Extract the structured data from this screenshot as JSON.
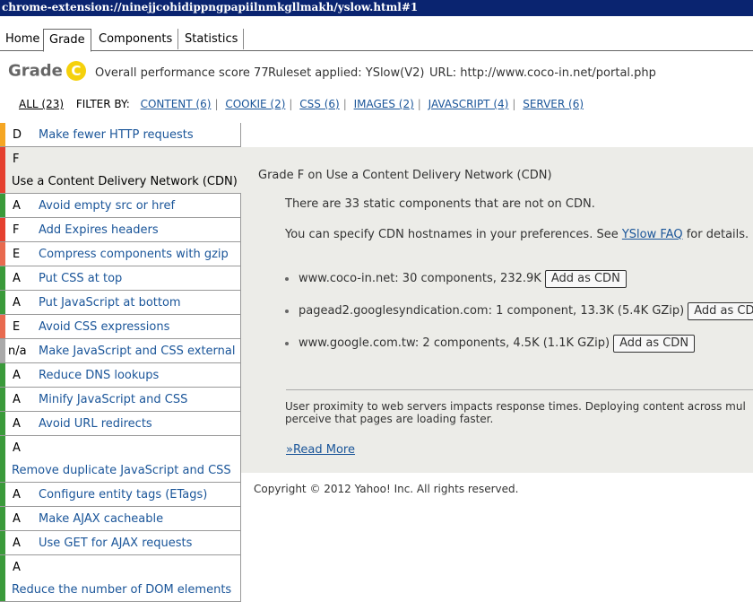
{
  "window": {
    "url": "chrome-extension://ninejjcohidippngpapiilnmkgllmakh/yslow.html#1"
  },
  "tabs": [
    {
      "label": "Home",
      "active": false
    },
    {
      "label": "Grade",
      "active": true
    },
    {
      "label": "Components",
      "active": false
    },
    {
      "label": "Statistics",
      "active": false
    }
  ],
  "header": {
    "title": "Grade",
    "grade": "C",
    "score": "Overall performance score 77",
    "ruleset": "Ruleset applied: YSlow(V2)",
    "url": "URL: http://www.coco-in.net/portal.php"
  },
  "filter": {
    "all": "ALL (23)",
    "label": "FILTER BY:",
    "items": [
      "CONTENT (6)",
      "COOKIE (2)",
      "CSS (6)",
      "IMAGES (2)",
      "JAVASCRIPT (4)",
      "SERVER (6)"
    ]
  },
  "rules": [
    {
      "grade": "D",
      "title": "Make fewer HTTP requests",
      "color": "#f5a623"
    },
    {
      "grade": "F",
      "title": "Use a Content Delivery Network (CDN)",
      "color": "#e5402f"
    },
    {
      "grade": "A",
      "title": "Avoid empty src or href",
      "color": "#3a9a3a"
    },
    {
      "grade": "F",
      "title": "Add Expires headers",
      "color": "#e5402f"
    },
    {
      "grade": "E",
      "title": "Compress components with gzip",
      "color": "#e86a4f"
    },
    {
      "grade": "A",
      "title": "Put CSS at top",
      "color": "#3a9a3a"
    },
    {
      "grade": "A",
      "title": "Put JavaScript at bottom",
      "color": "#3a9a3a"
    },
    {
      "grade": "E",
      "title": "Avoid CSS expressions",
      "color": "#e86a4f"
    },
    {
      "grade": "n/a",
      "title": "Make JavaScript and CSS external",
      "color": "#aaaaaa"
    },
    {
      "grade": "A",
      "title": "Reduce DNS lookups",
      "color": "#3a9a3a"
    },
    {
      "grade": "A",
      "title": "Minify JavaScript and CSS",
      "color": "#3a9a3a"
    },
    {
      "grade": "A",
      "title": "Avoid URL redirects",
      "color": "#3a9a3a"
    },
    {
      "grade": "A",
      "title": "Remove duplicate JavaScript and CSS",
      "color": "#3a9a3a"
    },
    {
      "grade": "A",
      "title": "Configure entity tags (ETags)",
      "color": "#3a9a3a"
    },
    {
      "grade": "A",
      "title": "Make AJAX cacheable",
      "color": "#3a9a3a"
    },
    {
      "grade": "A",
      "title": "Use GET for AJAX requests",
      "color": "#3a9a3a"
    },
    {
      "grade": "A",
      "title": "Reduce the number of DOM elements",
      "color": "#3a9a3a"
    }
  ],
  "panel": {
    "title": "Grade F on Use a Content Delivery Network (CDN)",
    "line1": "There are 33 static components that are not on CDN.",
    "line2_pre": "You can specify CDN hostnames in your preferences. See ",
    "line2_link": "YSlow FAQ",
    "line2_post": " for details.",
    "cdn": [
      {
        "text": "www.coco-in.net: 30 components, 232.9K",
        "button": "Add as CDN"
      },
      {
        "text": "pagead2.googlesyndication.com: 1 component, 13.3K (5.4K GZip)",
        "button": "Add as CDN"
      },
      {
        "text": "www.google.com.tw: 2 components, 4.5K (1.1K GZip)",
        "button": "Add as CDN"
      }
    ],
    "desc1": "User proximity to web servers impacts response times. Deploying content across mul",
    "desc2": "perceive that pages are loading faster.",
    "read_more": "»Read More"
  },
  "footer": {
    "copyright": "Copyright © 2012 Yahoo! Inc. All rights reserved."
  }
}
